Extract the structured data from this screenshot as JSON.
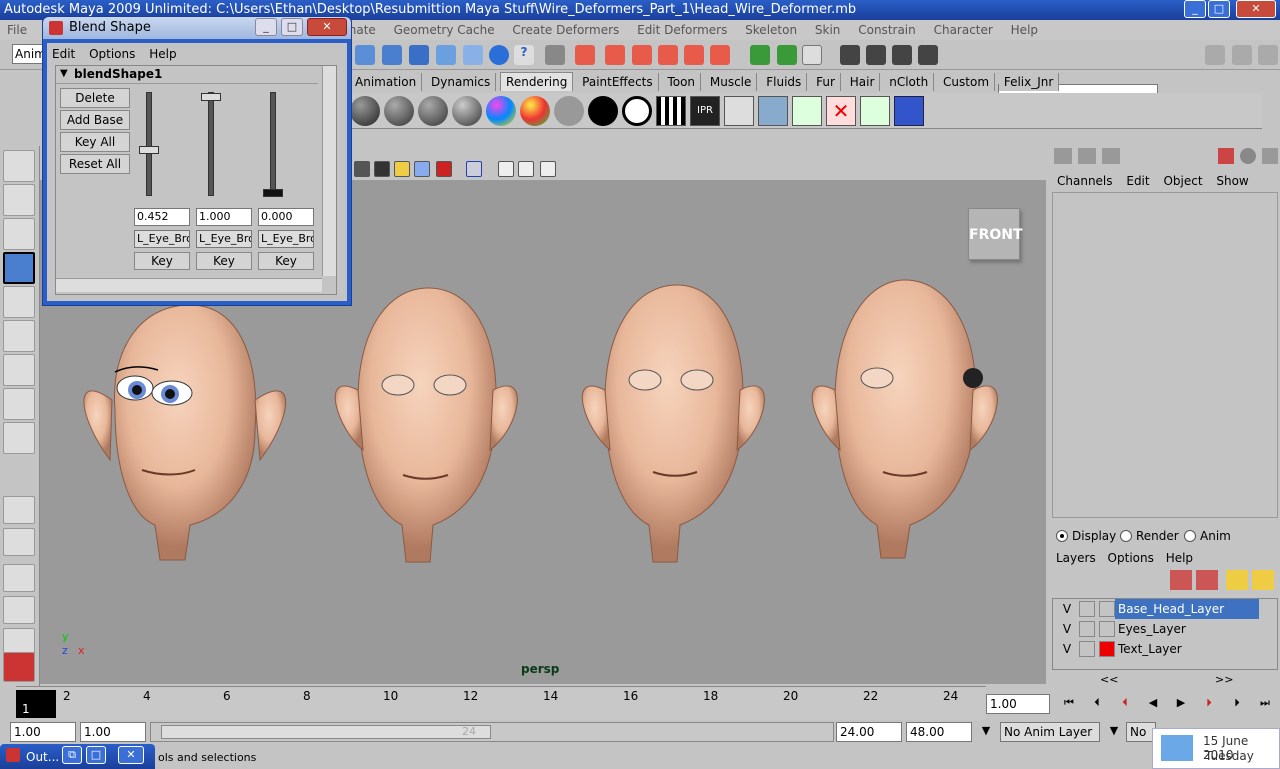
{
  "app": {
    "title": "Autodesk Maya 2009 Unlimited: C:\\Users\\Ethan\\Desktop\\Resubmittion Maya Stuff\\Wire_Deformers_Part_1\\Head_Wire_Deformer.mb"
  },
  "menubar": {
    "file": "File",
    "items": [
      "nate",
      "Geometry Cache",
      "Create Deformers",
      "Edit Deformers",
      "Skeleton",
      "Skin",
      "Constrain",
      "Character",
      "Help"
    ]
  },
  "mode_selector": "Anim",
  "shelf": {
    "tabs": [
      "Animation",
      "Dynamics",
      "Rendering",
      "PaintEffects",
      "Toon",
      "Muscle",
      "Fluids",
      "Fur",
      "Hair",
      "nCloth",
      "Custom",
      "Felix_Jnr"
    ],
    "active_tab": "Rendering",
    "ipr_label": "IPR"
  },
  "blend_window": {
    "title": "Blend Shape",
    "menu": [
      "Edit",
      "Options",
      "Help"
    ],
    "node_name": "blendShape1",
    "buttons": {
      "delete": "Delete",
      "add_base": "Add Base",
      "key_all": "Key All",
      "reset_all": "Reset All"
    },
    "targets": [
      {
        "weight": "0.452",
        "name": "L_Eye_Bro",
        "key": "Key",
        "level": 0.452
      },
      {
        "weight": "1.000",
        "name": "L_Eye_Bro",
        "key": "Key",
        "level": 1.0
      },
      {
        "weight": "0.000",
        "name": "L_Eye_Bro",
        "key": "Key",
        "level": 0.0
      }
    ]
  },
  "viewport": {
    "front_label": "FRONT",
    "camera": "persp",
    "axis_y": "y",
    "axis_z": "z",
    "axis_x": "x"
  },
  "channel_box": {
    "menu": [
      "Channels",
      "Edit",
      "Object",
      "Show"
    ]
  },
  "layer_editor": {
    "modes": [
      "Display",
      "Render",
      "Anim"
    ],
    "selected_mode": "Display",
    "menu": [
      "Layers",
      "Options",
      "Help"
    ],
    "layers": [
      {
        "visible": "V",
        "name": "Base_Head_Layer",
        "color": "#c4c4c4",
        "selected": true
      },
      {
        "visible": "V",
        "name": "Eyes_Layer",
        "color": "#c4c4c4",
        "selected": false
      },
      {
        "visible": "V",
        "name": "Text_Layer",
        "color": "#ee0000",
        "selected": false
      }
    ],
    "scroll_left": "<<",
    "scroll_right": ">>"
  },
  "timeline": {
    "current_frame": "1",
    "ticks": [
      "2",
      "4",
      "6",
      "8",
      "10",
      "12",
      "14",
      "16",
      "18",
      "20",
      "22",
      "24"
    ],
    "current_time_field": "1.00"
  },
  "range": {
    "start": "1.00",
    "playback_start": "1.00",
    "slider_end_label": "24",
    "playback_end": "24.00",
    "end": "48.00",
    "anim_layer": "No Anim Layer",
    "char_set": "No C"
  },
  "help_line": {
    "text": "ols and selections"
  },
  "outliner_min": {
    "label": "Out..."
  },
  "clock": {
    "date": "15 June 2010",
    "day": "Tuesday"
  },
  "colors": {
    "title_blue": "#2a5fc8",
    "viewport_bg": "#9a9a9a",
    "skin": "#e8b79a"
  }
}
